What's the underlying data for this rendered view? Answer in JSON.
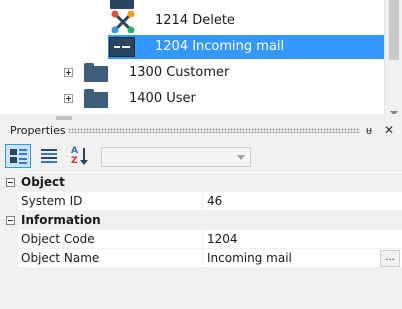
{
  "tree": {
    "items": [
      {
        "label": "1214 Delete",
        "icon": "delete-icon"
      },
      {
        "label": "1204 Incoming mail",
        "icon": "mail-icon",
        "selected": true
      },
      {
        "label": "1300 Customer",
        "icon": "folder-icon"
      },
      {
        "label": "1400 User",
        "icon": "folder-icon"
      }
    ]
  },
  "properties": {
    "title": "Properties",
    "pin_icon": "pin-icon",
    "close_icon": "close-icon",
    "pin_glyph": "ᵾ",
    "close_glyph": "✕",
    "toolbar": {
      "buttons": [
        "categorized-view-icon",
        "alphabetical-list-icon",
        "sort-az-icon"
      ],
      "az_top": "A",
      "az_bottom": "Z",
      "dropdown_value": ""
    },
    "grid": {
      "categories": [
        {
          "label": "Object",
          "rows": [
            {
              "name": "System ID",
              "value": "46"
            }
          ]
        },
        {
          "label": "Information",
          "rows": [
            {
              "name": "Object Code",
              "value": "1204"
            },
            {
              "name": "Object Name",
              "value": "Incoming mail"
            }
          ]
        }
      ],
      "ellipsis_label": "..."
    }
  },
  "colors": {
    "selection": "#3399ff",
    "icon_navy": "#2b4460",
    "folder": "#3e5d7b"
  }
}
